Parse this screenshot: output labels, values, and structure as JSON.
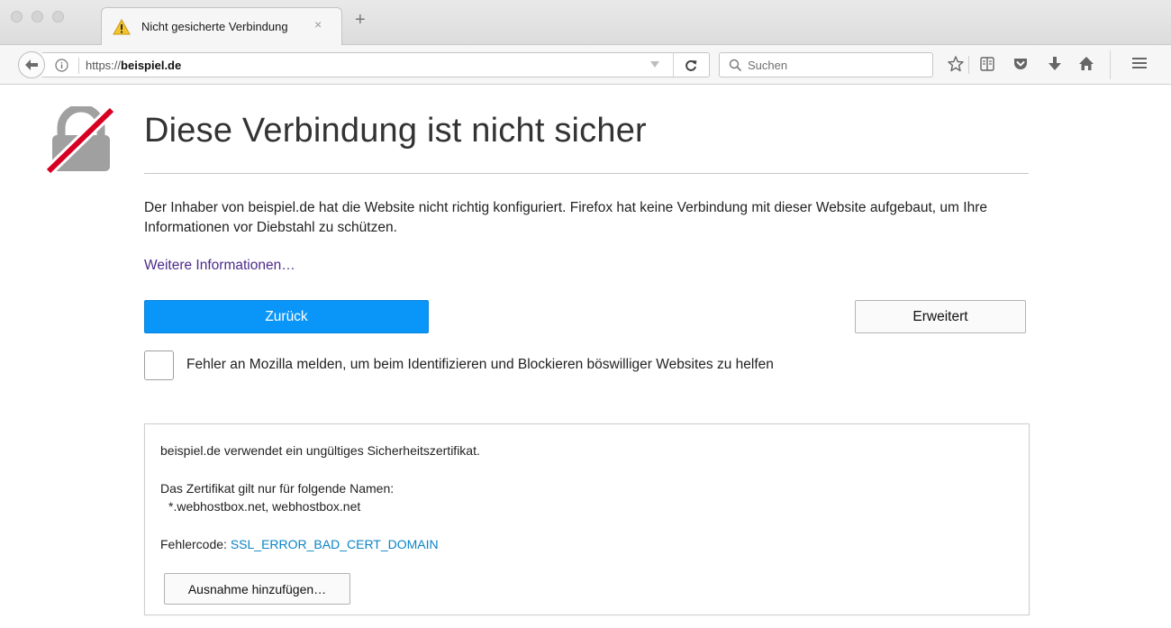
{
  "tab": {
    "title": "Nicht gesicherte Verbindung",
    "close_glyph": "×",
    "new_tab_glyph": "+",
    "icon": "warning-icon"
  },
  "navbar": {
    "url_prefix": "https://",
    "url_domain": "beispiel.de",
    "reload_glyph": "C",
    "search_placeholder": "Suchen",
    "icons": [
      "back-arrow-icon",
      "info-icon",
      "dropdown-icon",
      "reload-icon",
      "search-icon",
      "bookmark-star-icon",
      "reading-list-icon",
      "pocket-icon",
      "download-icon",
      "home-icon",
      "menu-icon"
    ]
  },
  "page": {
    "title": "Diese Verbindung ist nicht sicher",
    "description": "Der Inhaber von beispiel.de hat die Website nicht richtig konfiguriert. Firefox hat keine Verbindung mit dieser Website aufgebaut, um Ihre Informationen vor Diebstahl zu schützen.",
    "more_info_link": "Weitere Informationen…",
    "back_button": "Zurück",
    "advanced_button": "Erweitert",
    "report_checkbox_label": "Fehler an Mozilla melden, um beim Identifizieren und Blockieren böswilliger Websites zu helfen",
    "report_checked": false
  },
  "details": {
    "line1": "beispiel.de verwendet ein ungültiges Sicherheitszertifikat.",
    "line2": "Das Zertifikat gilt nur für folgende Namen:",
    "names": "*.webhostbox.net, webhostbox.net",
    "error_label": "Fehlercode: ",
    "error_code": "SSL_ERROR_BAD_CERT_DOMAIN",
    "exception_button": "Ausnahme hinzufügen…"
  },
  "colors": {
    "primary_button": "#0996f8",
    "link_purple": "#4c2a8a",
    "error_code_blue": "#0a84c6",
    "lock_strike_red": "#d70022",
    "lock_gray": "#999999"
  }
}
